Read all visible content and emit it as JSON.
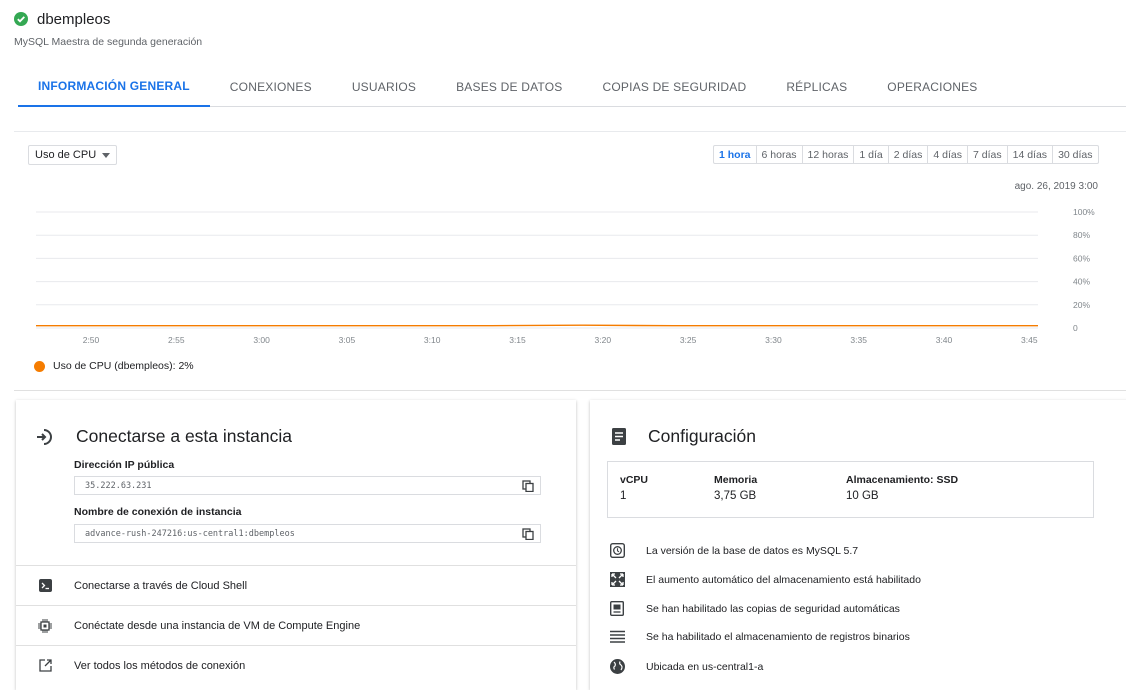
{
  "header": {
    "instance_name": "dbempleos",
    "subtitle": "MySQL Maestra de segunda generación",
    "status_color": "#34a853"
  },
  "tabs": [
    {
      "label": "INFORMACIÓN GENERAL",
      "active": true
    },
    {
      "label": "CONEXIONES",
      "active": false
    },
    {
      "label": "USUARIOS",
      "active": false
    },
    {
      "label": "BASES DE DATOS",
      "active": false
    },
    {
      "label": "COPIAS DE SEGURIDAD",
      "active": false
    },
    {
      "label": "RÉPLICAS",
      "active": false
    },
    {
      "label": "OPERACIONES",
      "active": false
    }
  ],
  "chart_panel": {
    "metric_select": "Uso de CPU",
    "ranges": [
      "1 hora",
      "6 horas",
      "12 horas",
      "1 día",
      "2 días",
      "4 días",
      "7 días",
      "14 días",
      "30 días"
    ],
    "active_range": "1 hora",
    "date_label": "ago. 26, 2019 3:00",
    "legend_label": "Uso de CPU (dbempleos): 2%"
  },
  "chart_data": {
    "type": "line",
    "x": [
      "2:50",
      "2:55",
      "3:00",
      "3:05",
      "3:10",
      "3:15",
      "3:20",
      "3:25",
      "3:30",
      "3:35",
      "3:40",
      "3:45"
    ],
    "series": [
      {
        "name": "Uso de CPU (dbempleos): 2%",
        "color": "#f57c00",
        "values": [
          2,
          2,
          2,
          2,
          2,
          2,
          2.4,
          2,
          2,
          2,
          2,
          2
        ]
      }
    ],
    "y_ticks": [
      "0",
      "20%",
      "40%",
      "60%",
      "80%",
      "100%"
    ],
    "ylim": [
      0,
      100
    ],
    "grid": true
  },
  "connect_card": {
    "title": "Conectarse a esta instancia",
    "ip_label": "Dirección IP pública",
    "ip_value": "35.222.63.231",
    "conn_name_label": "Nombre de conexión de instancia",
    "conn_name_value": "advance-rush-247216:us-central1:dbempleos",
    "actions": [
      {
        "label": "Conectarse a través de Cloud Shell",
        "icon": "terminal-icon"
      },
      {
        "label": "Conéctate desde una instancia de VM de Compute Engine",
        "icon": "chip-icon"
      },
      {
        "label": "Ver todos los métodos de conexión",
        "icon": "open-in-new-icon"
      }
    ]
  },
  "config_card": {
    "title": "Configuración",
    "specs": [
      {
        "header": "vCPU",
        "value": "1"
      },
      {
        "header": "Memoria",
        "value": "3,75 GB"
      },
      {
        "header": "Almacenamiento: SSD",
        "value": "10 GB"
      }
    ],
    "info": [
      {
        "text": "La versión de la base de datos es MySQL 5.7",
        "icon": "version-icon"
      },
      {
        "text": "El aumento automático del almacenamiento está habilitado",
        "icon": "expand-icon"
      },
      {
        "text": "Se han habilitado las copias de seguridad automáticas",
        "icon": "backup-icon"
      },
      {
        "text": "Se ha habilitado el almacenamiento de registros binarios",
        "icon": "list-icon"
      },
      {
        "text": "Ubicada en us-central1-a",
        "icon": "globe-icon"
      }
    ]
  }
}
